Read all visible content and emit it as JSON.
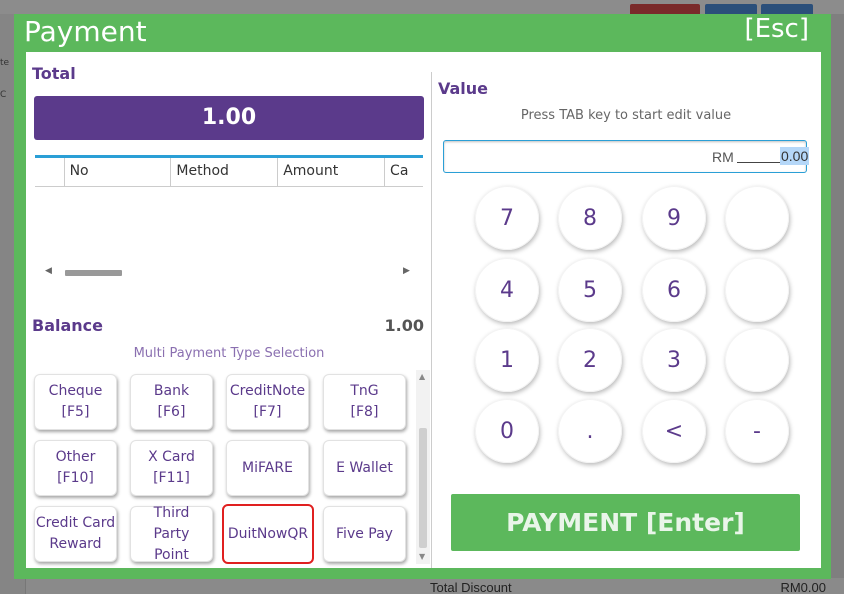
{
  "background": {
    "bottom_label": "Total Discount",
    "bottom_value": "RM0.00",
    "left_texts": [
      "te",
      "C"
    ]
  },
  "dialog": {
    "title": "Payment",
    "esc_label": "[Esc]"
  },
  "total": {
    "label": "Total",
    "value": "1.00"
  },
  "grid": {
    "columns": [
      "",
      "No",
      "Method",
      "Amount",
      "Ca"
    ]
  },
  "balance": {
    "label": "Balance",
    "value": "1.00"
  },
  "multi_label": "Multi Payment Type Selection",
  "payment_types": [
    {
      "label": "Cheque\n[F5]",
      "selected": false
    },
    {
      "label": "Bank\n[F6]",
      "selected": false
    },
    {
      "label": "CreditNote\n[F7]",
      "selected": false
    },
    {
      "label": "TnG\n   [F8]",
      "selected": false
    },
    {
      "label": "Other\n[F10]",
      "selected": false
    },
    {
      "label": "X Card\n[F11]",
      "selected": false
    },
    {
      "label": "MiFARE\n ",
      "selected": false
    },
    {
      "label": "E Wallet",
      "selected": false
    },
    {
      "label": "Credit Card\nReward",
      "selected": false
    },
    {
      "label": "Third\nParty\nPoint",
      "selected": false
    },
    {
      "label": "DuitNowQR",
      "selected": true
    },
    {
      "label": "Five Pay",
      "selected": false
    }
  ],
  "value": {
    "label": "Value",
    "hint": "Press TAB key to start edit value",
    "currency": "RM",
    "amount": "0.00"
  },
  "keypad": [
    "7",
    "8",
    "9",
    "",
    "4",
    "5",
    "6",
    "",
    "1",
    "2",
    "3",
    "",
    "0",
    ".",
    "<",
    "-"
  ],
  "payment_button": "PAYMENT [Enter]",
  "colors": {
    "dialog_green": "#5cb85c",
    "accent_purple": "#5b3a8b",
    "selected_border": "#e02020"
  }
}
